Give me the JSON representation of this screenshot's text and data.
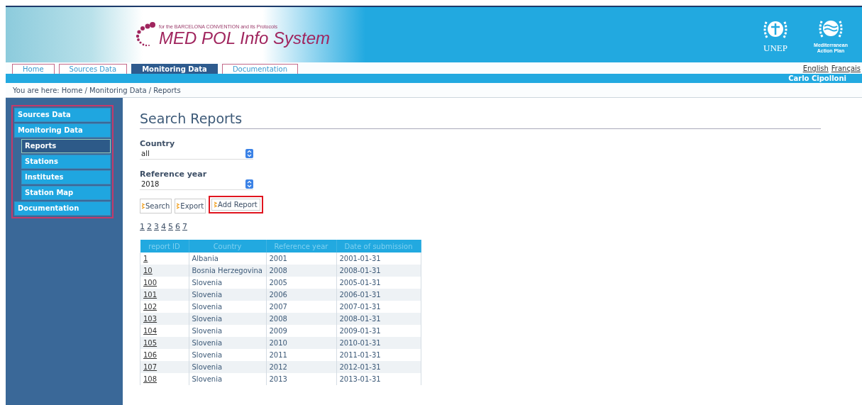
{
  "header": {
    "tagline": "for the BARCELONA CONVENTION and its Protocols",
    "title": "MED POL Info System",
    "logos": [
      {
        "kind": "unep",
        "caption": "UNEP"
      },
      {
        "kind": "map",
        "caption": "Mediterranean Action Plan"
      }
    ]
  },
  "tabs": [
    {
      "label": "Home",
      "selected": false
    },
    {
      "label": "Sources Data",
      "selected": false
    },
    {
      "label": "Monitoring Data",
      "selected": true
    },
    {
      "label": "Documentation",
      "selected": false
    }
  ],
  "languages": [
    "English",
    "Français"
  ],
  "user": "Carlo Cipolloni",
  "breadcrumb": "You are here: Home / Monitoring Data / Reports",
  "sidebar": {
    "items": [
      {
        "label": "Sources Data",
        "selected": false
      },
      {
        "label": "Monitoring Data",
        "selected": false,
        "children": [
          {
            "label": "Reports",
            "selected": true
          },
          {
            "label": "Stations",
            "selected": false
          },
          {
            "label": "Institutes",
            "selected": false
          },
          {
            "label": "Station Map",
            "selected": false
          }
        ]
      },
      {
        "label": "Documentation",
        "selected": false
      }
    ]
  },
  "heading": "Search Reports",
  "filters": [
    {
      "label": "Country",
      "value": "all"
    },
    {
      "label": "Reference year",
      "value": "2018"
    }
  ],
  "buttons": [
    {
      "label": "Search",
      "highlighted": false
    },
    {
      "label": "Export",
      "highlighted": false
    },
    {
      "label": "Add Report",
      "highlighted": true
    }
  ],
  "pages": [
    "1",
    "2",
    "3",
    "4",
    "5",
    "6",
    "7"
  ],
  "table": {
    "columns": [
      "report ID",
      "Country",
      "Reference year",
      "Date of submission"
    ],
    "rows": [
      [
        "1",
        "Albania",
        "2001",
        "2001-01-31"
      ],
      [
        "10",
        "Bosnia Herzegovina",
        "2008",
        "2008-01-31"
      ],
      [
        "100",
        "Slovenia",
        "2005",
        "2005-01-31"
      ],
      [
        "101",
        "Slovenia",
        "2006",
        "2006-01-31"
      ],
      [
        "102",
        "Slovenia",
        "2007",
        "2007-01-31"
      ],
      [
        "103",
        "Slovenia",
        "2008",
        "2008-01-31"
      ],
      [
        "104",
        "Slovenia",
        "2009",
        "2009-01-31"
      ],
      [
        "105",
        "Slovenia",
        "2010",
        "2010-01-31"
      ],
      [
        "106",
        "Slovenia",
        "2011",
        "2011-01-31"
      ],
      [
        "107",
        "Slovenia",
        "2012",
        "2012-01-31"
      ],
      [
        "108",
        "Slovenia",
        "2013",
        "2013-01-31"
      ]
    ]
  }
}
